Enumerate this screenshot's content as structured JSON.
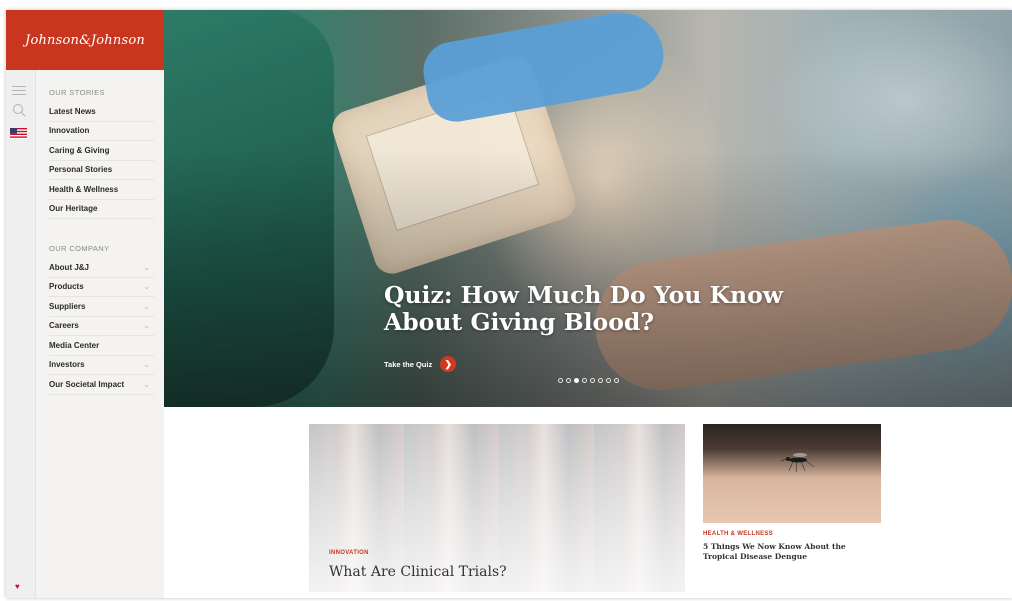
{
  "brand": {
    "logo_text": "Johnson&Johnson",
    "accent_color": "#c8361f"
  },
  "rail": {
    "icons": [
      "menu-icon",
      "search-icon",
      "us-flag-icon",
      "heart-icon"
    ]
  },
  "sidebar": {
    "stories_heading": "OUR STORIES",
    "stories": [
      {
        "label": "Latest News"
      },
      {
        "label": "Innovation"
      },
      {
        "label": "Caring & Giving"
      },
      {
        "label": "Personal Stories"
      },
      {
        "label": "Health & Wellness"
      },
      {
        "label": "Our Heritage"
      }
    ],
    "company_heading": "OUR COMPANY",
    "company": [
      {
        "label": "About J&J",
        "has_submenu": true
      },
      {
        "label": "Products",
        "has_submenu": true
      },
      {
        "label": "Suppliers",
        "has_submenu": true
      },
      {
        "label": "Careers",
        "has_submenu": true
      },
      {
        "label": "Media Center",
        "has_submenu": false
      },
      {
        "label": "Investors",
        "has_submenu": true
      },
      {
        "label": "Our Societal Impact",
        "has_submenu": true
      }
    ]
  },
  "hero": {
    "title": "Quiz: How Much Do You Know About Giving Blood?",
    "cta_label": "Take the Quiz",
    "carousel": {
      "total": 8,
      "active_index": 2
    }
  },
  "cards": {
    "main": {
      "category": "INNOVATION",
      "title": "What Are Clinical Trials?"
    },
    "side": {
      "category": "HEALTH & WELLNESS",
      "title": "5 Things We Now Know About the Tropical Disease Dengue"
    }
  }
}
